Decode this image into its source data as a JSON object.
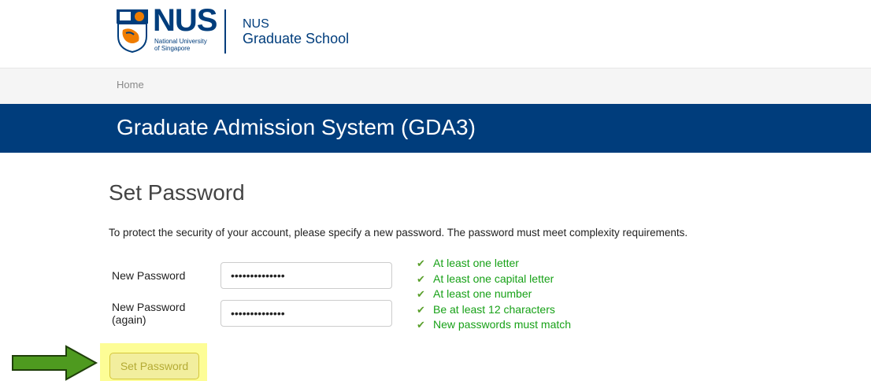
{
  "header": {
    "logo_word": "NUS",
    "logo_sub_line1": "National University",
    "logo_sub_line2": "of Singapore",
    "school_line1": "NUS",
    "school_line2": "Graduate School"
  },
  "breadcrumb": {
    "home": "Home"
  },
  "banner": {
    "title": "Graduate Admission System (GDA3)"
  },
  "form": {
    "title": "Set Password",
    "intro": "To protect the security of your account, please specify a new password. The password must meet complexity requirements.",
    "new_password_label": "New Password",
    "new_password_again_label_line1": "New Password",
    "new_password_again_label_line2": "(again)",
    "new_password_value": "••••••••••••••",
    "new_password_again_value": "••••••••••••••",
    "requirements": [
      "At least one letter",
      "At least one capital letter",
      "At least one number",
      "Be at least 12 characters",
      "New passwords must match"
    ],
    "submit_label": "Set Password"
  },
  "colors": {
    "brand_blue": "#003D7C",
    "requirement_green": "#17a117",
    "highlight_yellow": "#fdfd96",
    "arrow_green": "#4e9a1f"
  },
  "icons": {
    "requirement_icon": "checkmark-icon",
    "annotation_arrow": "right-arrow-icon"
  }
}
